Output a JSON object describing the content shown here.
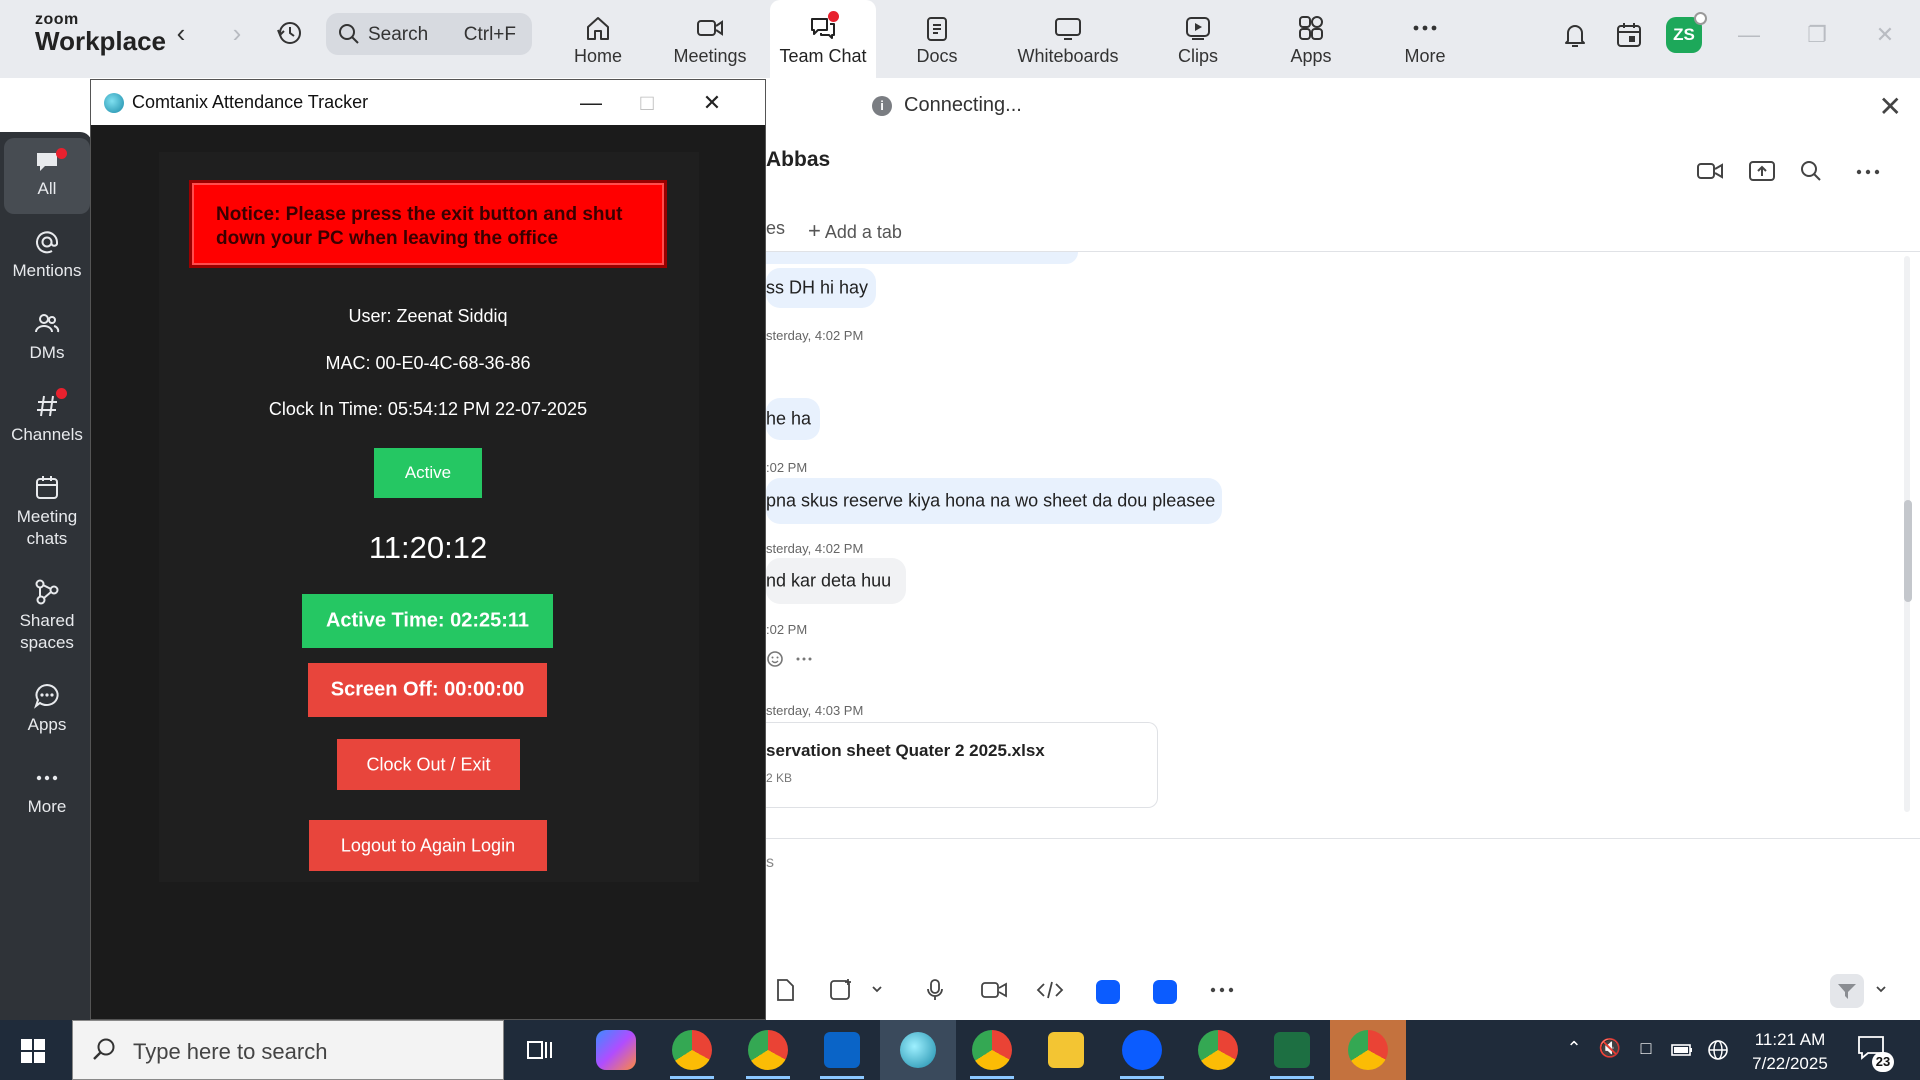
{
  "app": {
    "logo_top": "zoom",
    "logo_bottom": "Workplace"
  },
  "search": {
    "label": "Search",
    "shortcut": "Ctrl+F"
  },
  "tabs": [
    {
      "label": "Home"
    },
    {
      "label": "Meetings"
    },
    {
      "label": "Team Chat"
    },
    {
      "label": "Docs"
    },
    {
      "label": "Whiteboards"
    },
    {
      "label": "Clips"
    },
    {
      "label": "Apps"
    },
    {
      "label": "More"
    }
  ],
  "user": {
    "initials": "ZS"
  },
  "sidebar": {
    "items": [
      {
        "label": "All"
      },
      {
        "label": "Mentions"
      },
      {
        "label": "DMs"
      },
      {
        "label": "Channels"
      },
      {
        "label": "Meeting chats"
      },
      {
        "label": "Shared spaces"
      },
      {
        "label": "Apps"
      },
      {
        "label": "More"
      }
    ]
  },
  "chat": {
    "status": "Connecting...",
    "title": "Abbas",
    "tab_partial": "es",
    "add_tab": "Add a tab",
    "messages": [
      {
        "text": "ss DH hi hay"
      },
      {
        "meta": "sterday, 4:02 PM"
      },
      {
        "text": "he ha"
      },
      {
        "meta": ":02 PM"
      },
      {
        "text": "pna skus reserve kiya hona na wo sheet da dou pleasee"
      },
      {
        "meta": "sterday, 4:02 PM"
      },
      {
        "text": "nd kar deta huu"
      },
      {
        "meta": ":02 PM"
      },
      {
        "meta": "sterday, 4:03 PM"
      }
    ],
    "file": {
      "name": "servation sheet Quater 2 2025.xlsx",
      "size": "2 KB"
    },
    "composer_placeholder": "s"
  },
  "tracker": {
    "title": "Comtanix Attendance Tracker",
    "notice": "Notice: Please press the exit button and shut down your PC when leaving the office",
    "user_line": "User: Zeenat Siddiq",
    "mac_line": "MAC: 00-E0-4C-68-36-86",
    "clock_in_line": "Clock In Time: 05:54:12 PM 22-07-2025",
    "status_label": "Active",
    "clock": "11:20:12",
    "active_time": "Active Time: 02:25:11",
    "screen_off": "Screen Off: 00:00:00",
    "clock_out": "Clock Out / Exit",
    "logout": "Logout to Again Login"
  },
  "taskbar": {
    "search_placeholder": "Type here to search",
    "time": "11:21 AM",
    "date": "7/22/2025",
    "notifications": "23"
  },
  "colors": {
    "zoom_blue": "#0b5cff",
    "active_green": "#25c763",
    "button_red": "#e8453c",
    "notice_red": "#ff0000",
    "badge_red": "#e8212e"
  }
}
